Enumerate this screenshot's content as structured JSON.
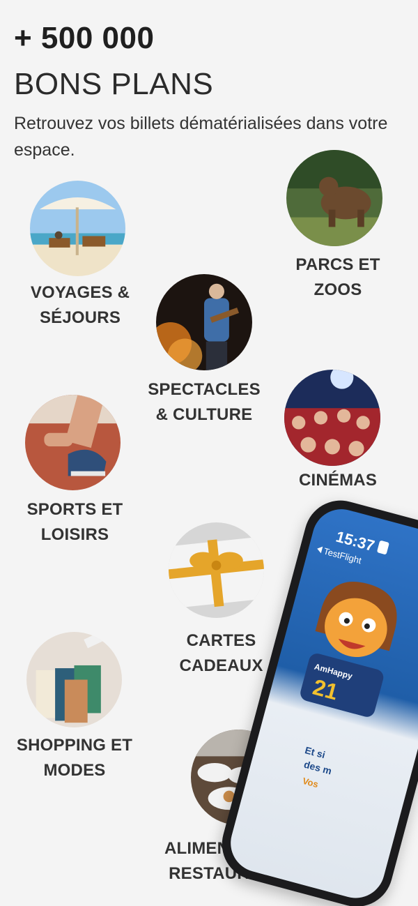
{
  "header": {
    "headline": "+ 500 000",
    "subhead": "BONS PLANS",
    "intro": "Retrouvez vos billets dématérialisées dans votre espace."
  },
  "categories": [
    {
      "line1": "VOYAGES &",
      "line2": "SÉJOURS"
    },
    {
      "line1": "PARCS ET",
      "line2": "ZOOS"
    },
    {
      "line1": "SPECTACLES",
      "line2": "& CULTURE"
    },
    {
      "line1": "CINÉMAS",
      "line2": ""
    },
    {
      "line1": "SPORTS ET",
      "line2": "LOISIRS"
    },
    {
      "line1": "CARTES",
      "line2": "CADEAUX"
    },
    {
      "line1": "SHOPPING ET",
      "line2": "MODES"
    },
    {
      "line1": "ALIMENTATION ET",
      "line2": "RESTAURATIONS"
    }
  ],
  "phone": {
    "time": "15:37",
    "back_label": "TestFlight",
    "jersey_brand": "AmHappy",
    "jersey_number": "21",
    "promo_line1": "Et si",
    "promo_line2": "des m",
    "promo_line3": "Vos"
  }
}
